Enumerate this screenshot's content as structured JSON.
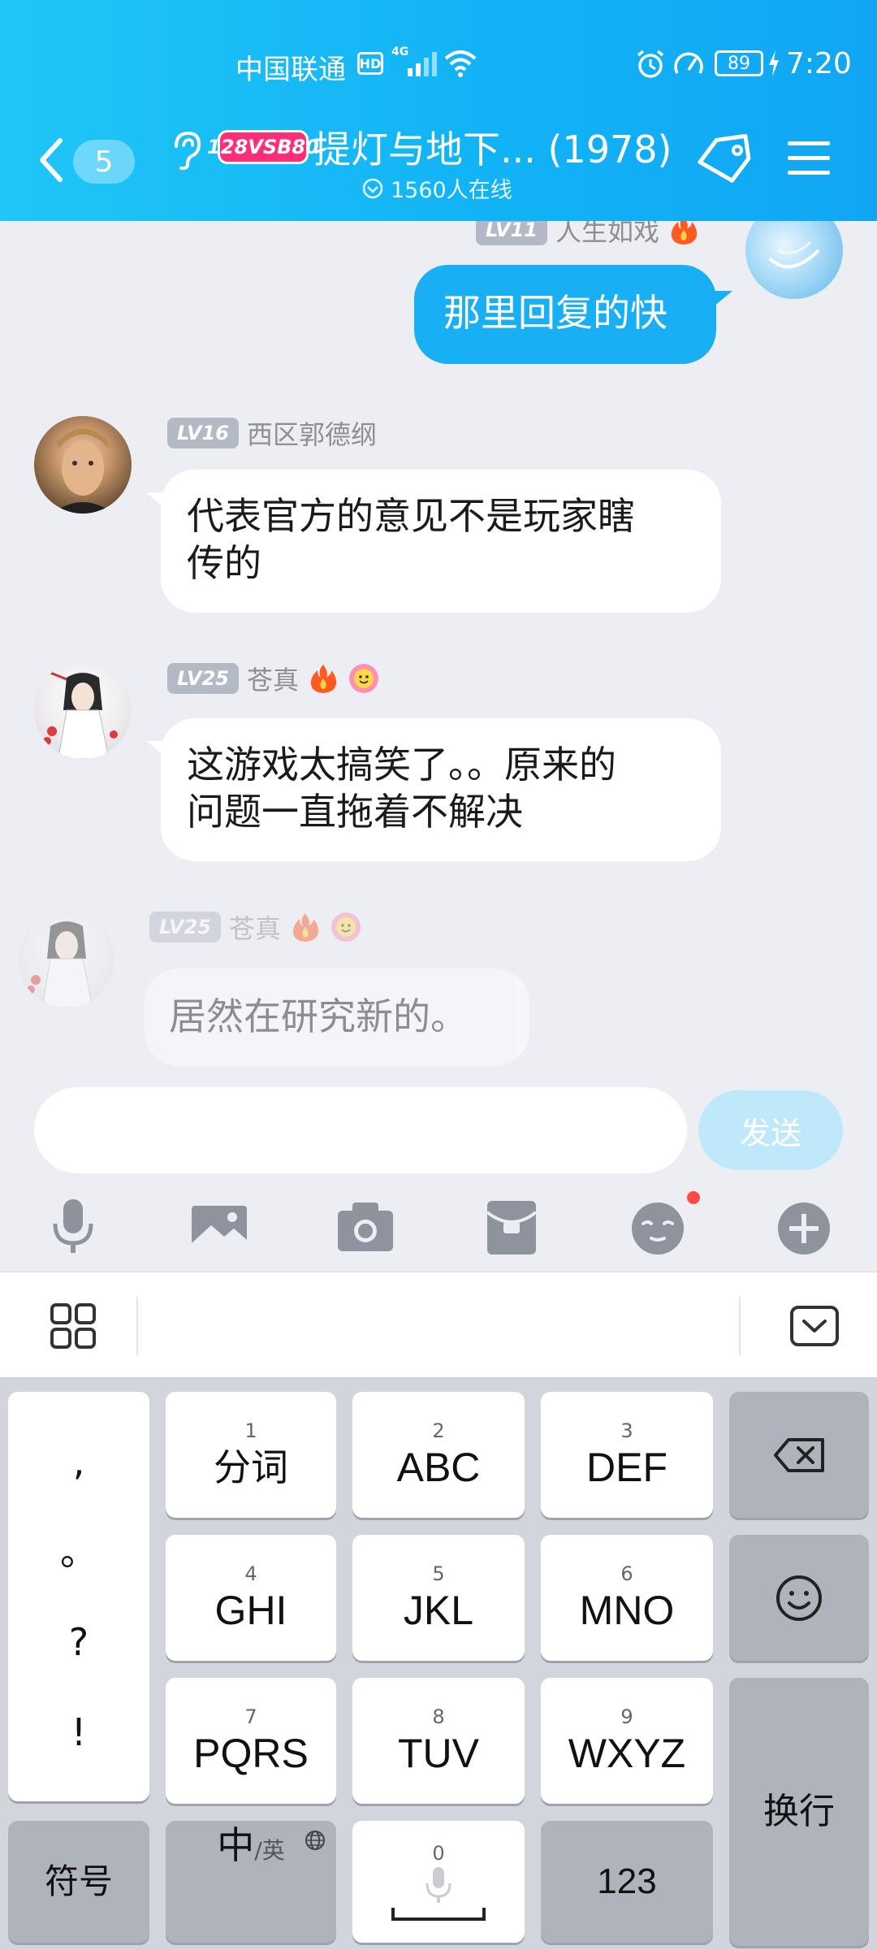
{
  "status_bar": {
    "carrier": "中国联通",
    "hd": "HD",
    "network": "4G",
    "battery": "89",
    "time": "7:20"
  },
  "header": {
    "unread_count": "5",
    "group_badge": "128VSB80",
    "title": "提灯与地下... (1978)",
    "online": "1560人在线"
  },
  "messages": [
    {
      "level": "LV11",
      "name": "人生如戏",
      "text": "那里回复的快"
    },
    {
      "level": "LV16",
      "name": "西区郭德纲",
      "text_line1": "代表官方的意见不是玩家瞎",
      "text_line2": "传的"
    },
    {
      "level": "LV25",
      "name": "苍真",
      "text_line1": "这游戏太搞笑了。。原来的",
      "text_line2": "问题一直拖着不解决"
    },
    {
      "level": "LV25",
      "name": "苍真",
      "text": "居然在研究新的。"
    }
  ],
  "input": {
    "value": "",
    "send_label": "发送"
  },
  "keyboard": {
    "punct": [
      ",",
      "。",
      "?",
      "!"
    ],
    "keys": [
      {
        "num": "1",
        "label": "分词"
      },
      {
        "num": "2",
        "label": "ABC"
      },
      {
        "num": "3",
        "label": "DEF"
      },
      {
        "num": "4",
        "label": "GHI"
      },
      {
        "num": "5",
        "label": "JKL"
      },
      {
        "num": "6",
        "label": "MNO"
      },
      {
        "num": "7",
        "label": "PQRS"
      },
      {
        "num": "8",
        "label": "TUV"
      },
      {
        "num": "9",
        "label": "WXYZ"
      }
    ],
    "symbols_label": "符号",
    "lang_main": "中",
    "lang_alt": "/英",
    "space_num": "0",
    "numbers_label": "123",
    "enter_label": "换行"
  },
  "colors": {
    "header_accent": "#12b3f6",
    "my_bubble": "#18aff5",
    "level_badge": "#b4b9c6",
    "notification_dot": "#ff4a4a"
  }
}
